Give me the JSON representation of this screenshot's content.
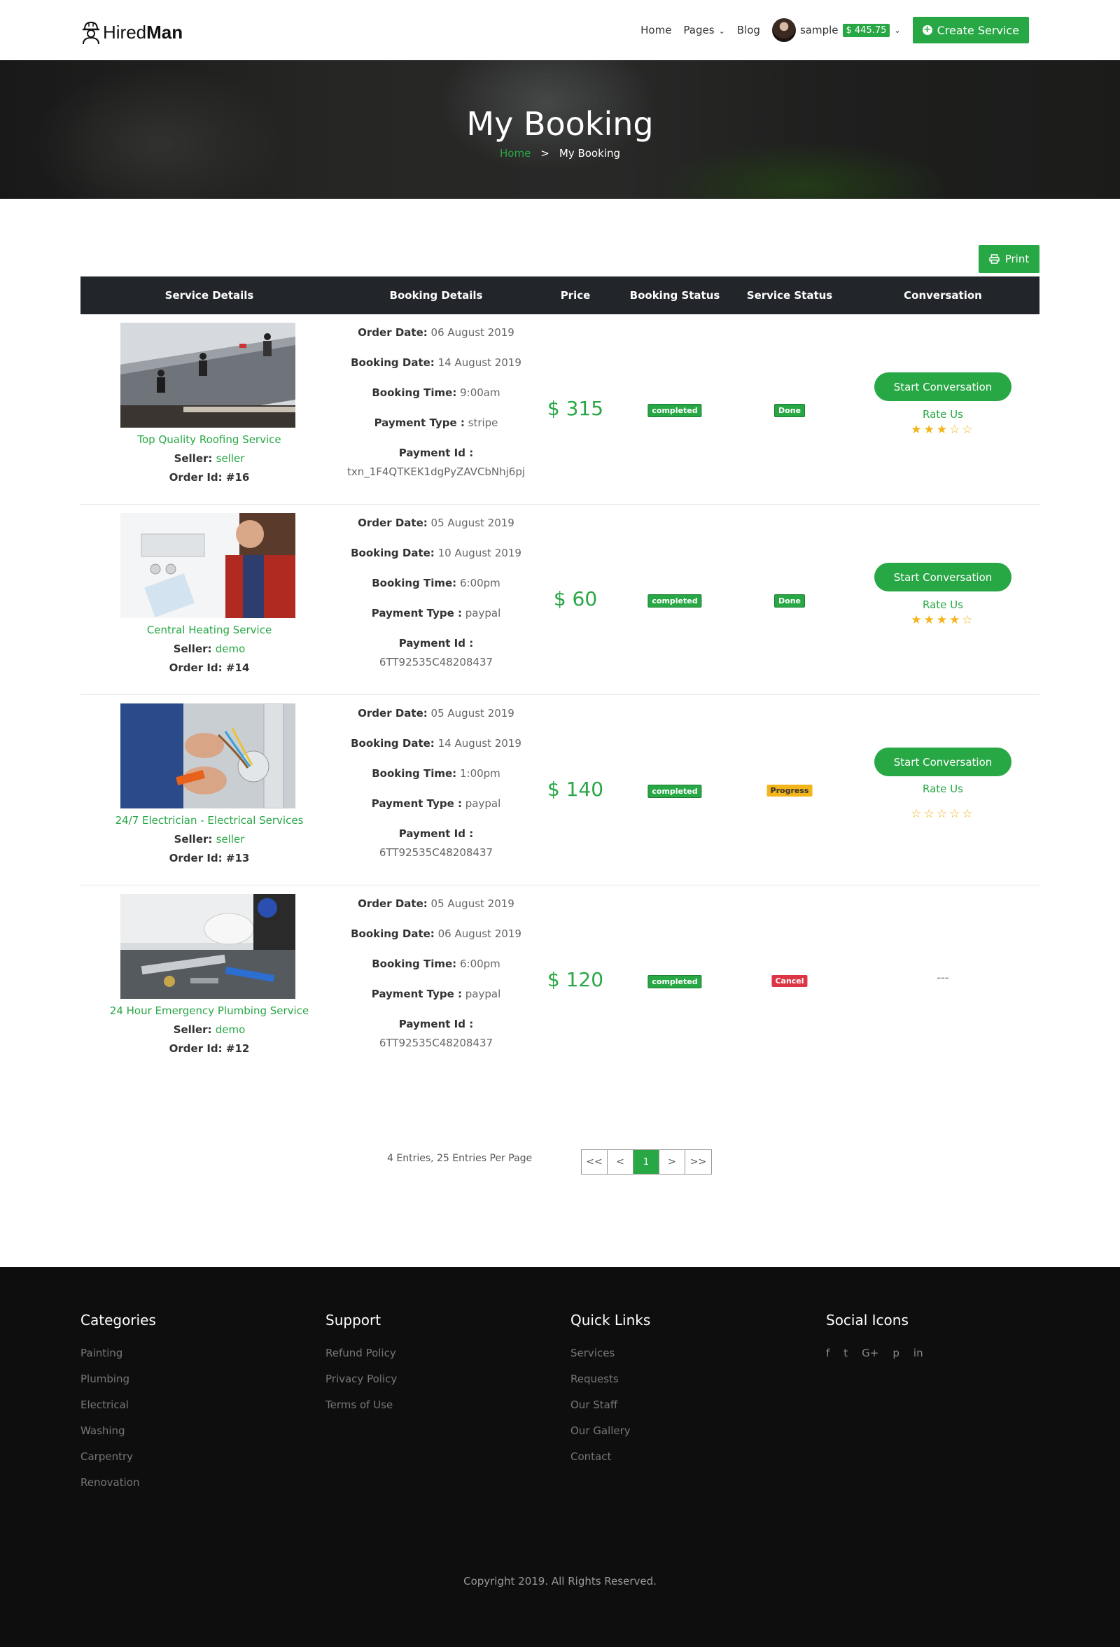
{
  "header": {
    "brand_light": "Hired",
    "brand_bold": "Man",
    "nav": {
      "home": "Home",
      "pages": "Pages",
      "blog": "Blog"
    },
    "user": {
      "name": "sample",
      "balance": "$ 445.75"
    },
    "create_service": "Create Service"
  },
  "hero": {
    "title": "My Booking",
    "crumb_home": "Home",
    "crumb_sep": ">",
    "crumb_current": "My Booking"
  },
  "print_label": "Print",
  "table": {
    "headers": [
      "Service Details",
      "Booking Details",
      "Price",
      "Booking Status",
      "Service Status",
      "Conversation"
    ],
    "labels": {
      "seller": "Seller:",
      "order_id": "Order Id:",
      "order_date": "Order Date:",
      "booking_date": "Booking Date:",
      "booking_time": "Booking Time:",
      "payment_type": "Payment Type :",
      "payment_id": "Payment Id :",
      "start_conversation": "Start Conversation",
      "rate_us": "Rate Us"
    },
    "rows": [
      {
        "service": "Top Quality Roofing Service",
        "seller": "seller",
        "order_id": "#16",
        "order_date": "06 August 2019",
        "booking_date": "14 August 2019",
        "booking_time": "9:00am",
        "payment_type": "stripe",
        "payment_id": "txn_1F4QTKEK1dgPyZAVCbNhj6pj",
        "price": "$ 315",
        "booking_status": "completed",
        "service_status": "Done",
        "rating": 3,
        "conversation": "buttons"
      },
      {
        "service": "Central Heating Service",
        "seller": "demo",
        "order_id": "#14",
        "order_date": "05 August 2019",
        "booking_date": "10 August 2019",
        "booking_time": "6:00pm",
        "payment_type": "paypal",
        "payment_id": "6TT92535C48208437",
        "price": "$ 60",
        "booking_status": "completed",
        "service_status": "Done",
        "rating": 4,
        "conversation": "buttons"
      },
      {
        "service": "24/7 Electrician - Electrical Services",
        "seller": "seller",
        "order_id": "#13",
        "order_date": "05 August 2019",
        "booking_date": "14 August 2019",
        "booking_time": "1:00pm",
        "payment_type": "paypal",
        "payment_id": "6TT92535C48208437",
        "price": "$ 140",
        "booking_status": "completed",
        "service_status": "Progress",
        "rating": 0,
        "conversation": "buttons"
      },
      {
        "service": "24 Hour Emergency Plumbing Service",
        "seller": "demo",
        "order_id": "#12",
        "order_date": "05 August 2019",
        "booking_date": "06 August 2019",
        "booking_time": "6:00pm",
        "payment_type": "paypal",
        "payment_id": "6TT92535C48208437",
        "price": "$ 120",
        "booking_status": "completed",
        "service_status": "Cancel",
        "rating": 0,
        "conversation": "---"
      }
    ],
    "status_colors": {
      "Done": "#28a745",
      "Progress": "#f2b418",
      "Cancel": "#dc3545",
      "completed": "#28a745"
    }
  },
  "pagination": {
    "info": "4 Entries, 25 Entries Per Page",
    "first": "<<",
    "prev": "<",
    "current": "1",
    "next": ">",
    "last": ">>"
  },
  "footer": {
    "categories": {
      "title": "Categories",
      "items": [
        "Painting",
        "Plumbing",
        "Electrical",
        "Washing",
        "Carpentry",
        "Renovation"
      ]
    },
    "support": {
      "title": "Support",
      "items": [
        "Refund Policy",
        "Privacy Policy",
        "Terms of Use"
      ]
    },
    "quick_links": {
      "title": "Quick Links",
      "items": [
        "Services",
        "Requests",
        "Our Staff",
        "Our Gallery",
        "Contact"
      ]
    },
    "social": {
      "title": "Social Icons",
      "icons": [
        "f",
        "t",
        "G+",
        "p",
        "in"
      ]
    },
    "copyright": "Copyright 2019. All Rights Reserved."
  },
  "accent_color": "#28a745"
}
